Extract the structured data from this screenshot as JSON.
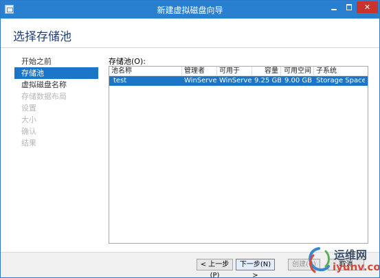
{
  "window": {
    "title": "新建虚拟磁盘向导",
    "controls": {
      "minimize": "",
      "maximize": "",
      "close": "✕"
    }
  },
  "header": {
    "title": "选择存储池"
  },
  "sidebar": {
    "items": [
      {
        "label": "开始之前",
        "state": "normal"
      },
      {
        "label": "存储池",
        "state": "active"
      },
      {
        "label": "虚拟磁盘名称",
        "state": "normal"
      },
      {
        "label": "存储数据布局",
        "state": "disabled"
      },
      {
        "label": "设置",
        "state": "disabled"
      },
      {
        "label": "大小",
        "state": "disabled"
      },
      {
        "label": "确认",
        "state": "disabled"
      },
      {
        "label": "结果",
        "state": "disabled"
      }
    ]
  },
  "main": {
    "pool_label": "存储池(O):",
    "columns": [
      "池名称",
      "管理者",
      "可用于",
      "容量",
      "可用空间",
      "子系统"
    ],
    "rows": [
      {
        "name": "test",
        "manager": "WinServer",
        "available_to": "WinServer",
        "capacity": "9.25 GB",
        "free_space": "9.00 GB",
        "subsystem": "Storage Spaces"
      }
    ]
  },
  "footer": {
    "prev": "< 上一步(P)",
    "next": "下一步(N) >",
    "create": "创建(C)",
    "cancel": "取消"
  },
  "watermark": {
    "top": "运维网",
    "bottom": "iyunv.com"
  },
  "colors": {
    "accent": "#1c75c7",
    "titlebar": "#2a80d0",
    "close": "#c9332b",
    "title_text": "#1f3f7a"
  }
}
